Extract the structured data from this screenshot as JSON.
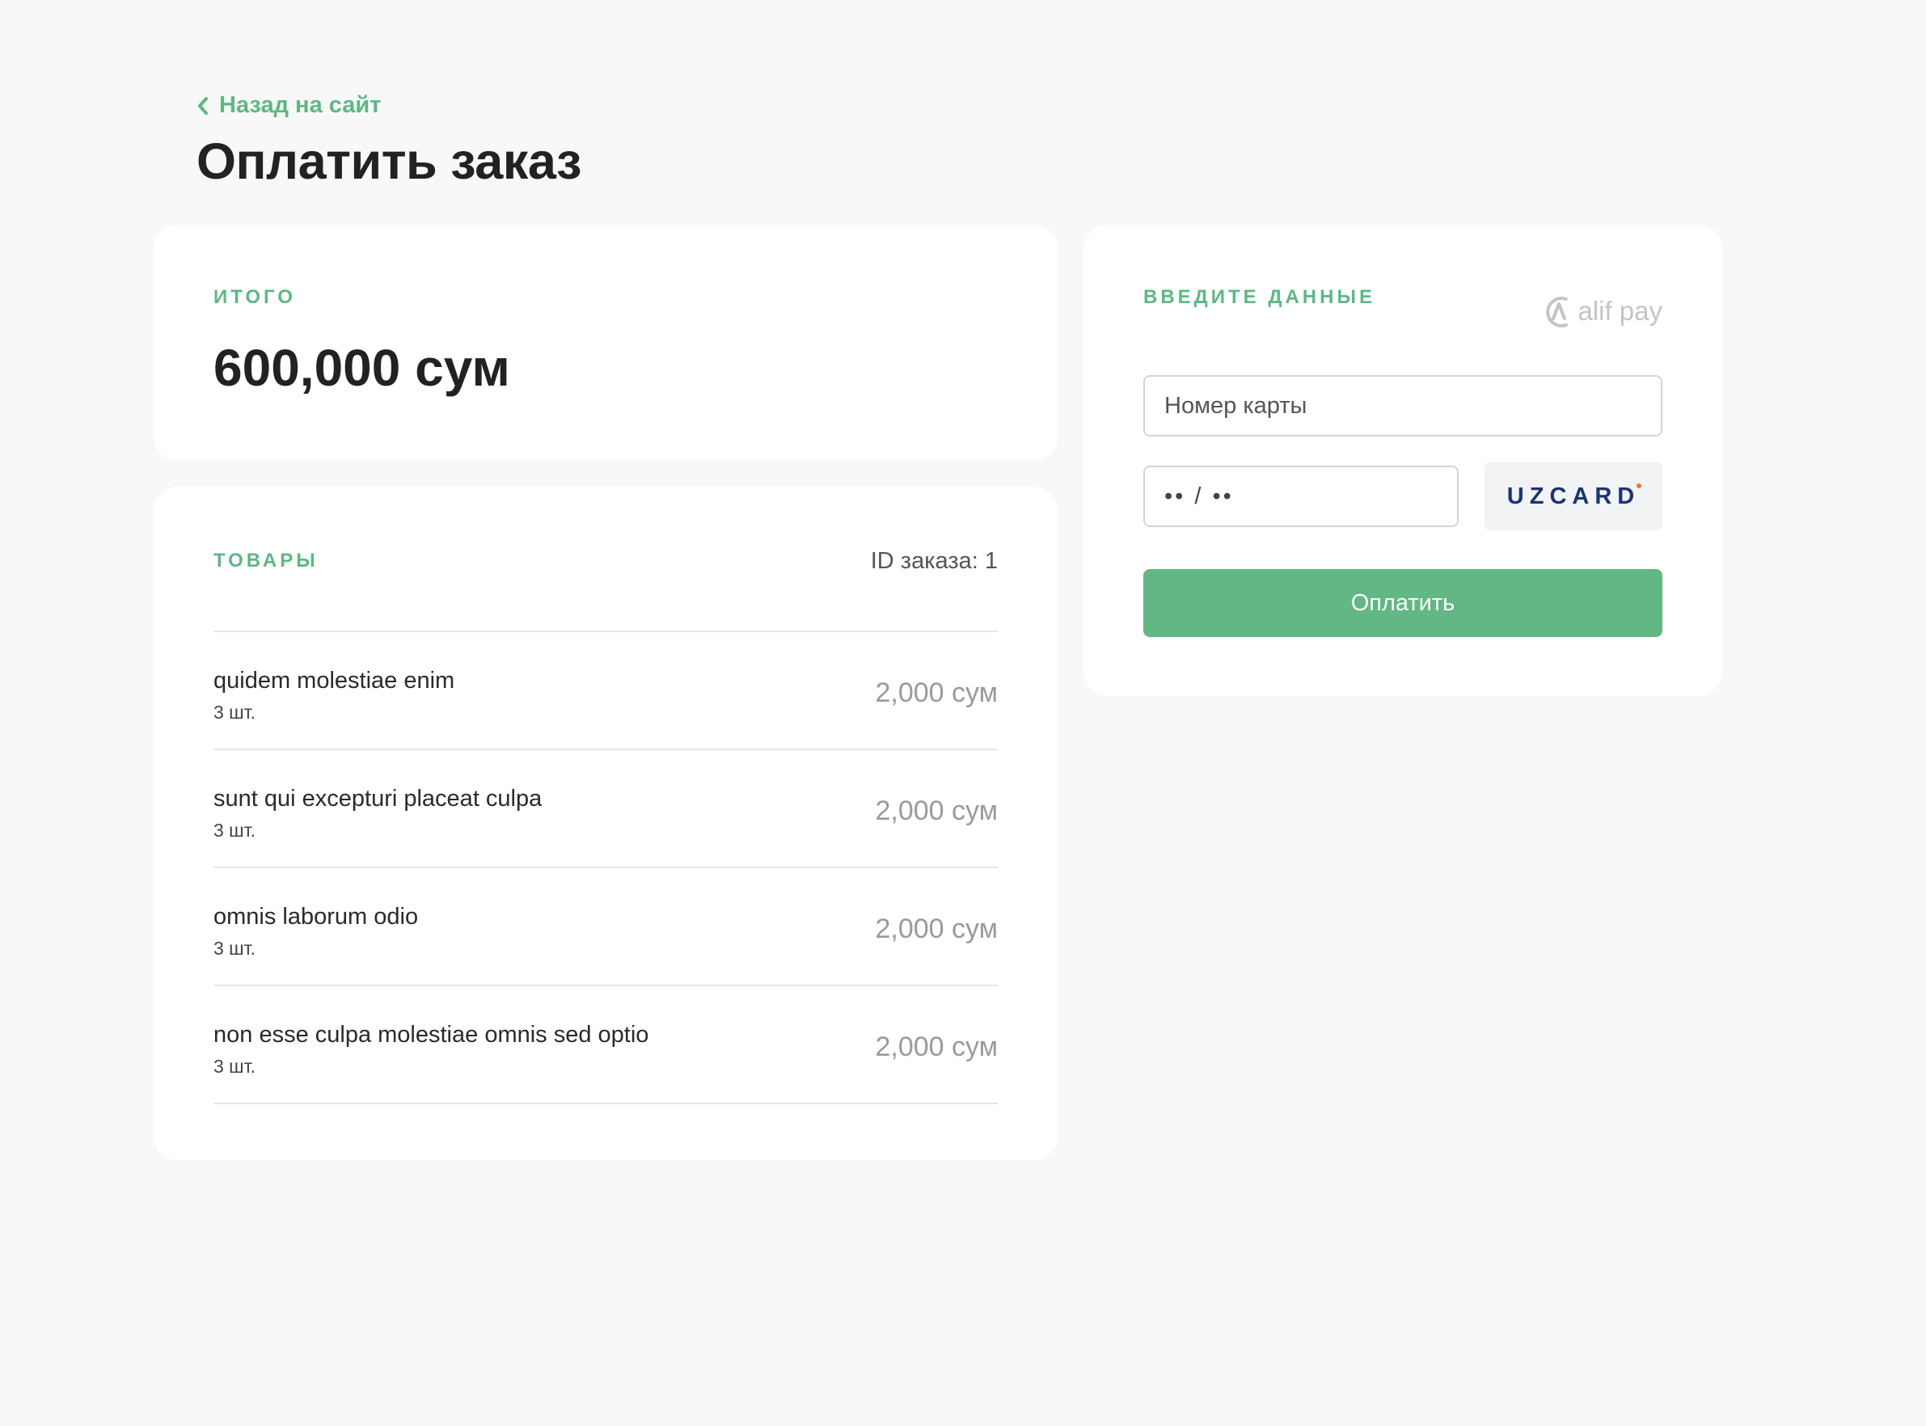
{
  "header": {
    "back_link": "Назад на сайт",
    "title": "Оплатить заказ"
  },
  "total": {
    "label": "ИТОГО",
    "amount": "600,000 сум"
  },
  "items": {
    "label": "ТОВАРЫ",
    "order_id": "ID заказа: 1",
    "rows": [
      {
        "name": "quidem molestiae enim",
        "qty": "3 шт.",
        "price": "2,000 сум"
      },
      {
        "name": "sunt qui excepturi placeat culpa",
        "qty": "3 шт.",
        "price": "2,000 сум"
      },
      {
        "name": "omnis laborum odio",
        "qty": "3 шт.",
        "price": "2,000 сум"
      },
      {
        "name": "non esse culpa molestiae omnis sed optio",
        "qty": "3 шт.",
        "price": "2,000 сум"
      }
    ]
  },
  "payment": {
    "label": "ВВЕДИТЕ ДАННЫЕ",
    "logo_text": "alif pay",
    "card_number_placeholder": "Номер карты",
    "expiry_placeholder": "•• / ••",
    "card_brand": "UZCARD",
    "pay_button": "Оплатить"
  },
  "colors": {
    "accent": "#5db883",
    "button": "#62b784",
    "background": "#f8f8f8",
    "uzcard": "#1a3372"
  }
}
